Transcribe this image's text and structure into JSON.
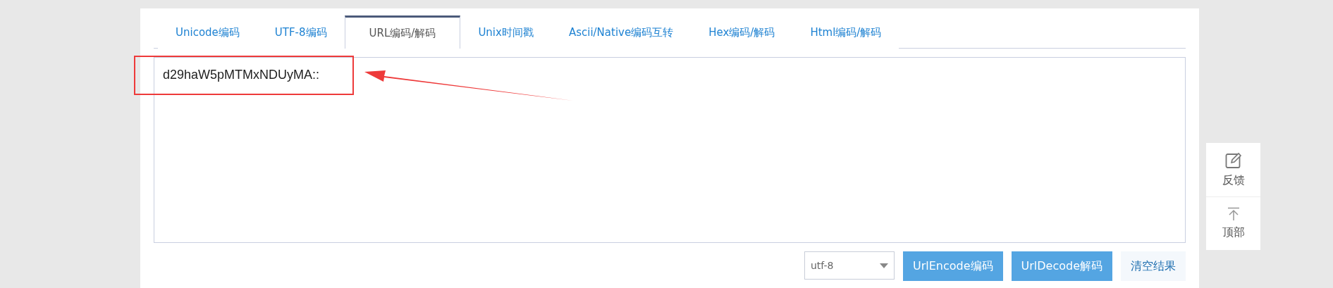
{
  "tabs": [
    {
      "label": "Unicode编码",
      "selected": false
    },
    {
      "label": "UTF-8编码",
      "selected": false
    },
    {
      "label": "URL编码/解码",
      "selected": true
    },
    {
      "label": "Unix时间戳",
      "selected": false
    },
    {
      "label": "Ascii/Native编码互转",
      "selected": false
    },
    {
      "label": "Hex编码/解码",
      "selected": false
    },
    {
      "label": "Html编码/解码",
      "selected": false
    }
  ],
  "input": {
    "value": "d29haW5pMTMxNDUyMA::"
  },
  "encoding_select": {
    "value": "utf-8"
  },
  "buttons": [
    {
      "label": "UrlEncode编码",
      "kind": "primary"
    },
    {
      "label": "UrlDecode解码",
      "kind": "primary"
    },
    {
      "label": "清空结果",
      "kind": "plain"
    }
  ],
  "side_tools": [
    {
      "label": "反馈",
      "kind": "feedback"
    },
    {
      "label": "顶部",
      "kind": "top"
    }
  ]
}
